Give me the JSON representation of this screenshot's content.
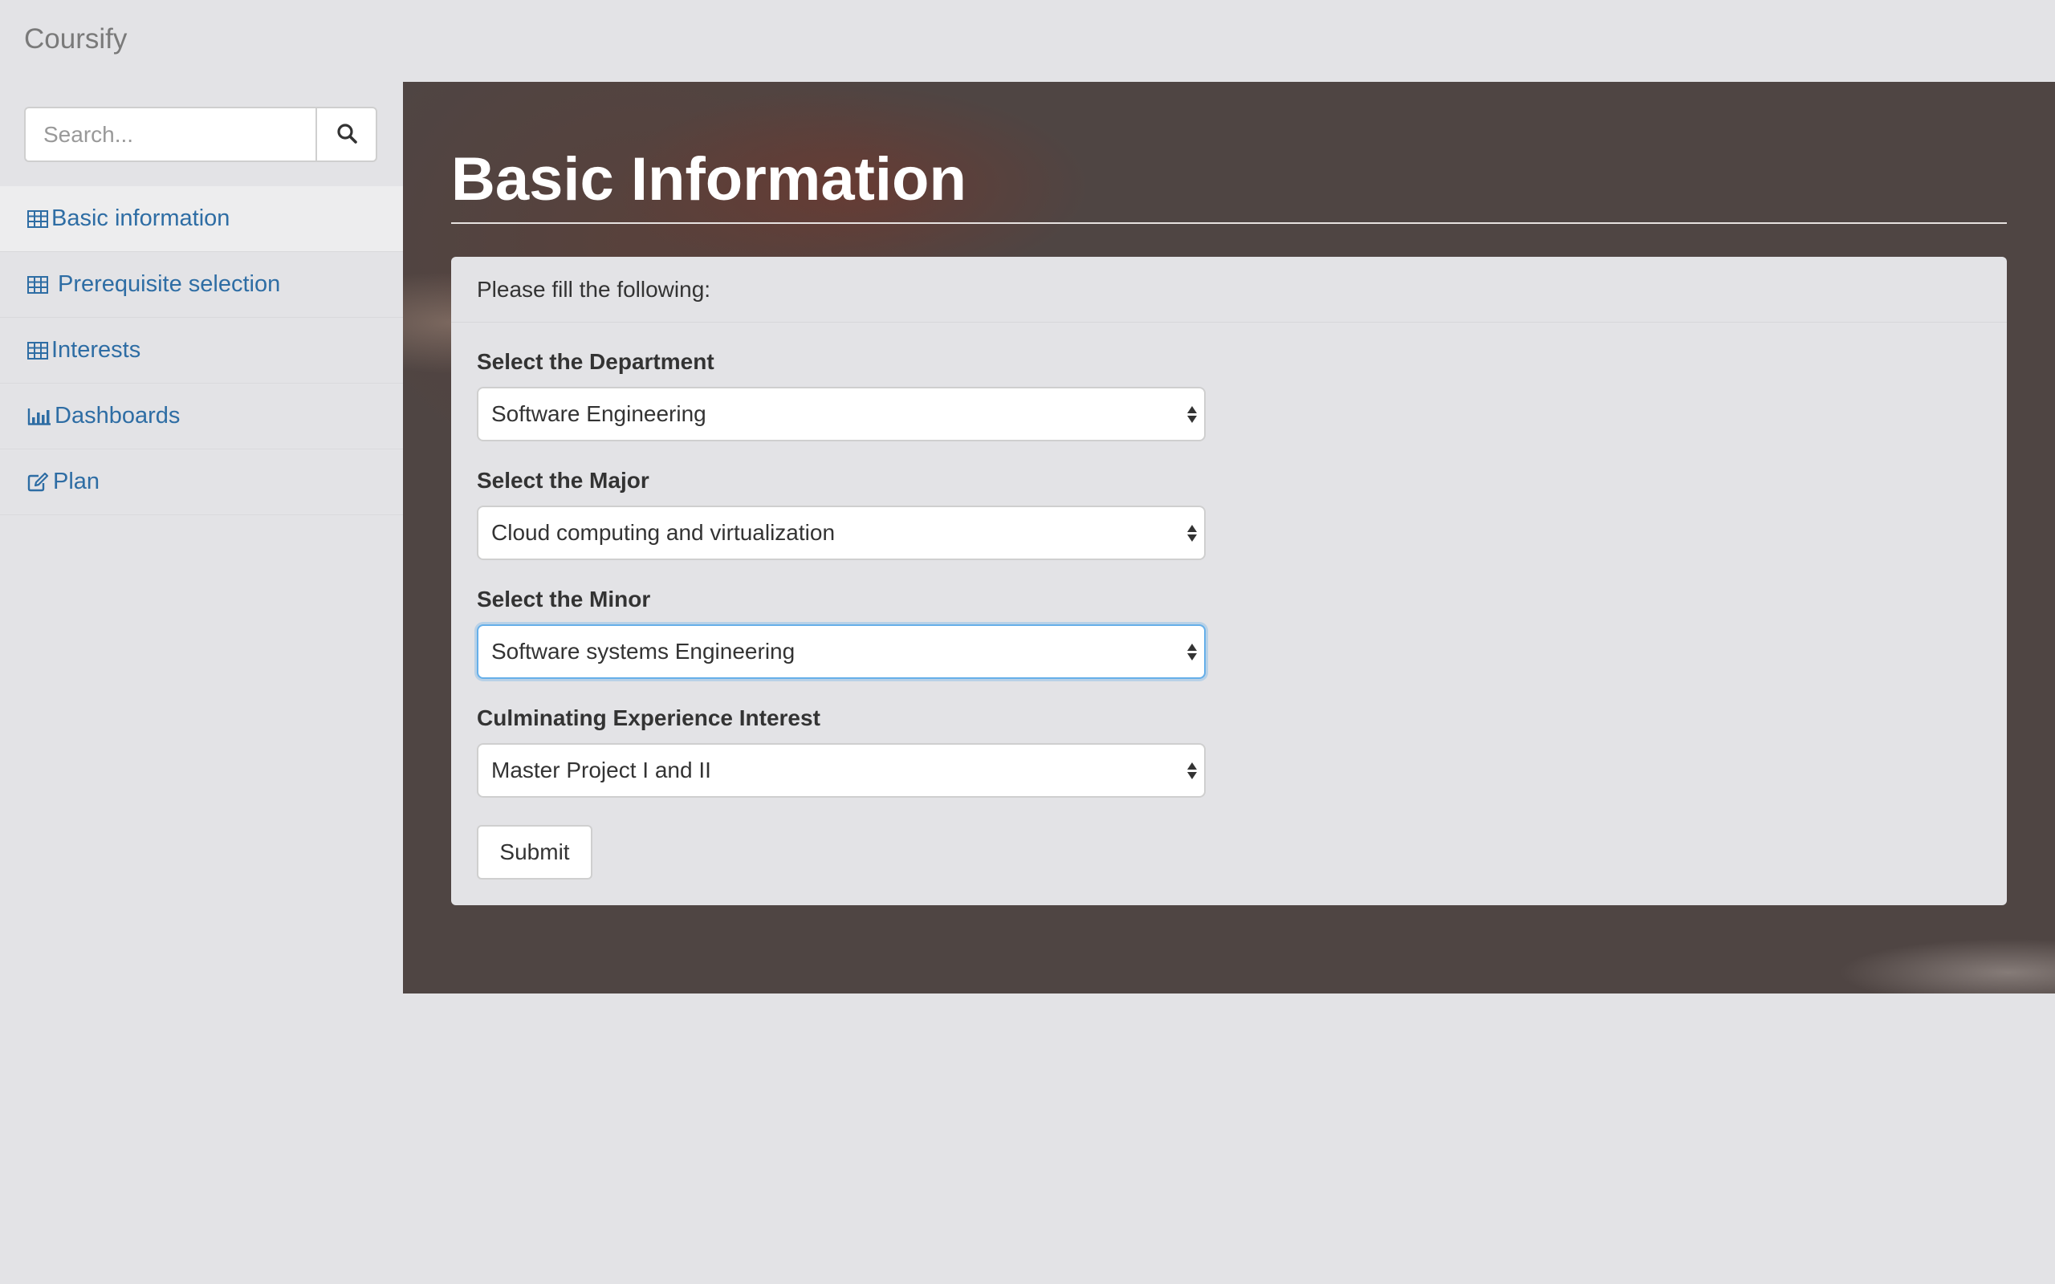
{
  "app": {
    "brand": "Coursify"
  },
  "search": {
    "placeholder": "Search...",
    "value": ""
  },
  "sidebar": {
    "items": [
      {
        "label": "Basic information",
        "icon": "table-icon",
        "active": true
      },
      {
        "label": "Prerequisite selection",
        "icon": "table-icon",
        "active": false
      },
      {
        "label": "Interests",
        "icon": "table-icon",
        "active": false
      },
      {
        "label": "Dashboards",
        "icon": "bar-chart-icon",
        "active": false
      },
      {
        "label": "Plan",
        "icon": "edit-icon",
        "active": false
      }
    ]
  },
  "main": {
    "title": "Basic Information",
    "panel_heading": "Please fill the following:",
    "fields": [
      {
        "label": "Select the Department",
        "value": "Software Engineering"
      },
      {
        "label": "Select the Major",
        "value": "Cloud computing and virtualization"
      },
      {
        "label": "Select the Minor",
        "value": "Software systems Engineering"
      },
      {
        "label": "Culminating Experience Interest",
        "value": "Master Project I and II"
      }
    ],
    "submit_label": "Submit"
  },
  "colors": {
    "link": "#2e6da4",
    "page_background": "#e3e3e6",
    "hero_background": "#4f4543",
    "focus_border": "#66afe9"
  }
}
